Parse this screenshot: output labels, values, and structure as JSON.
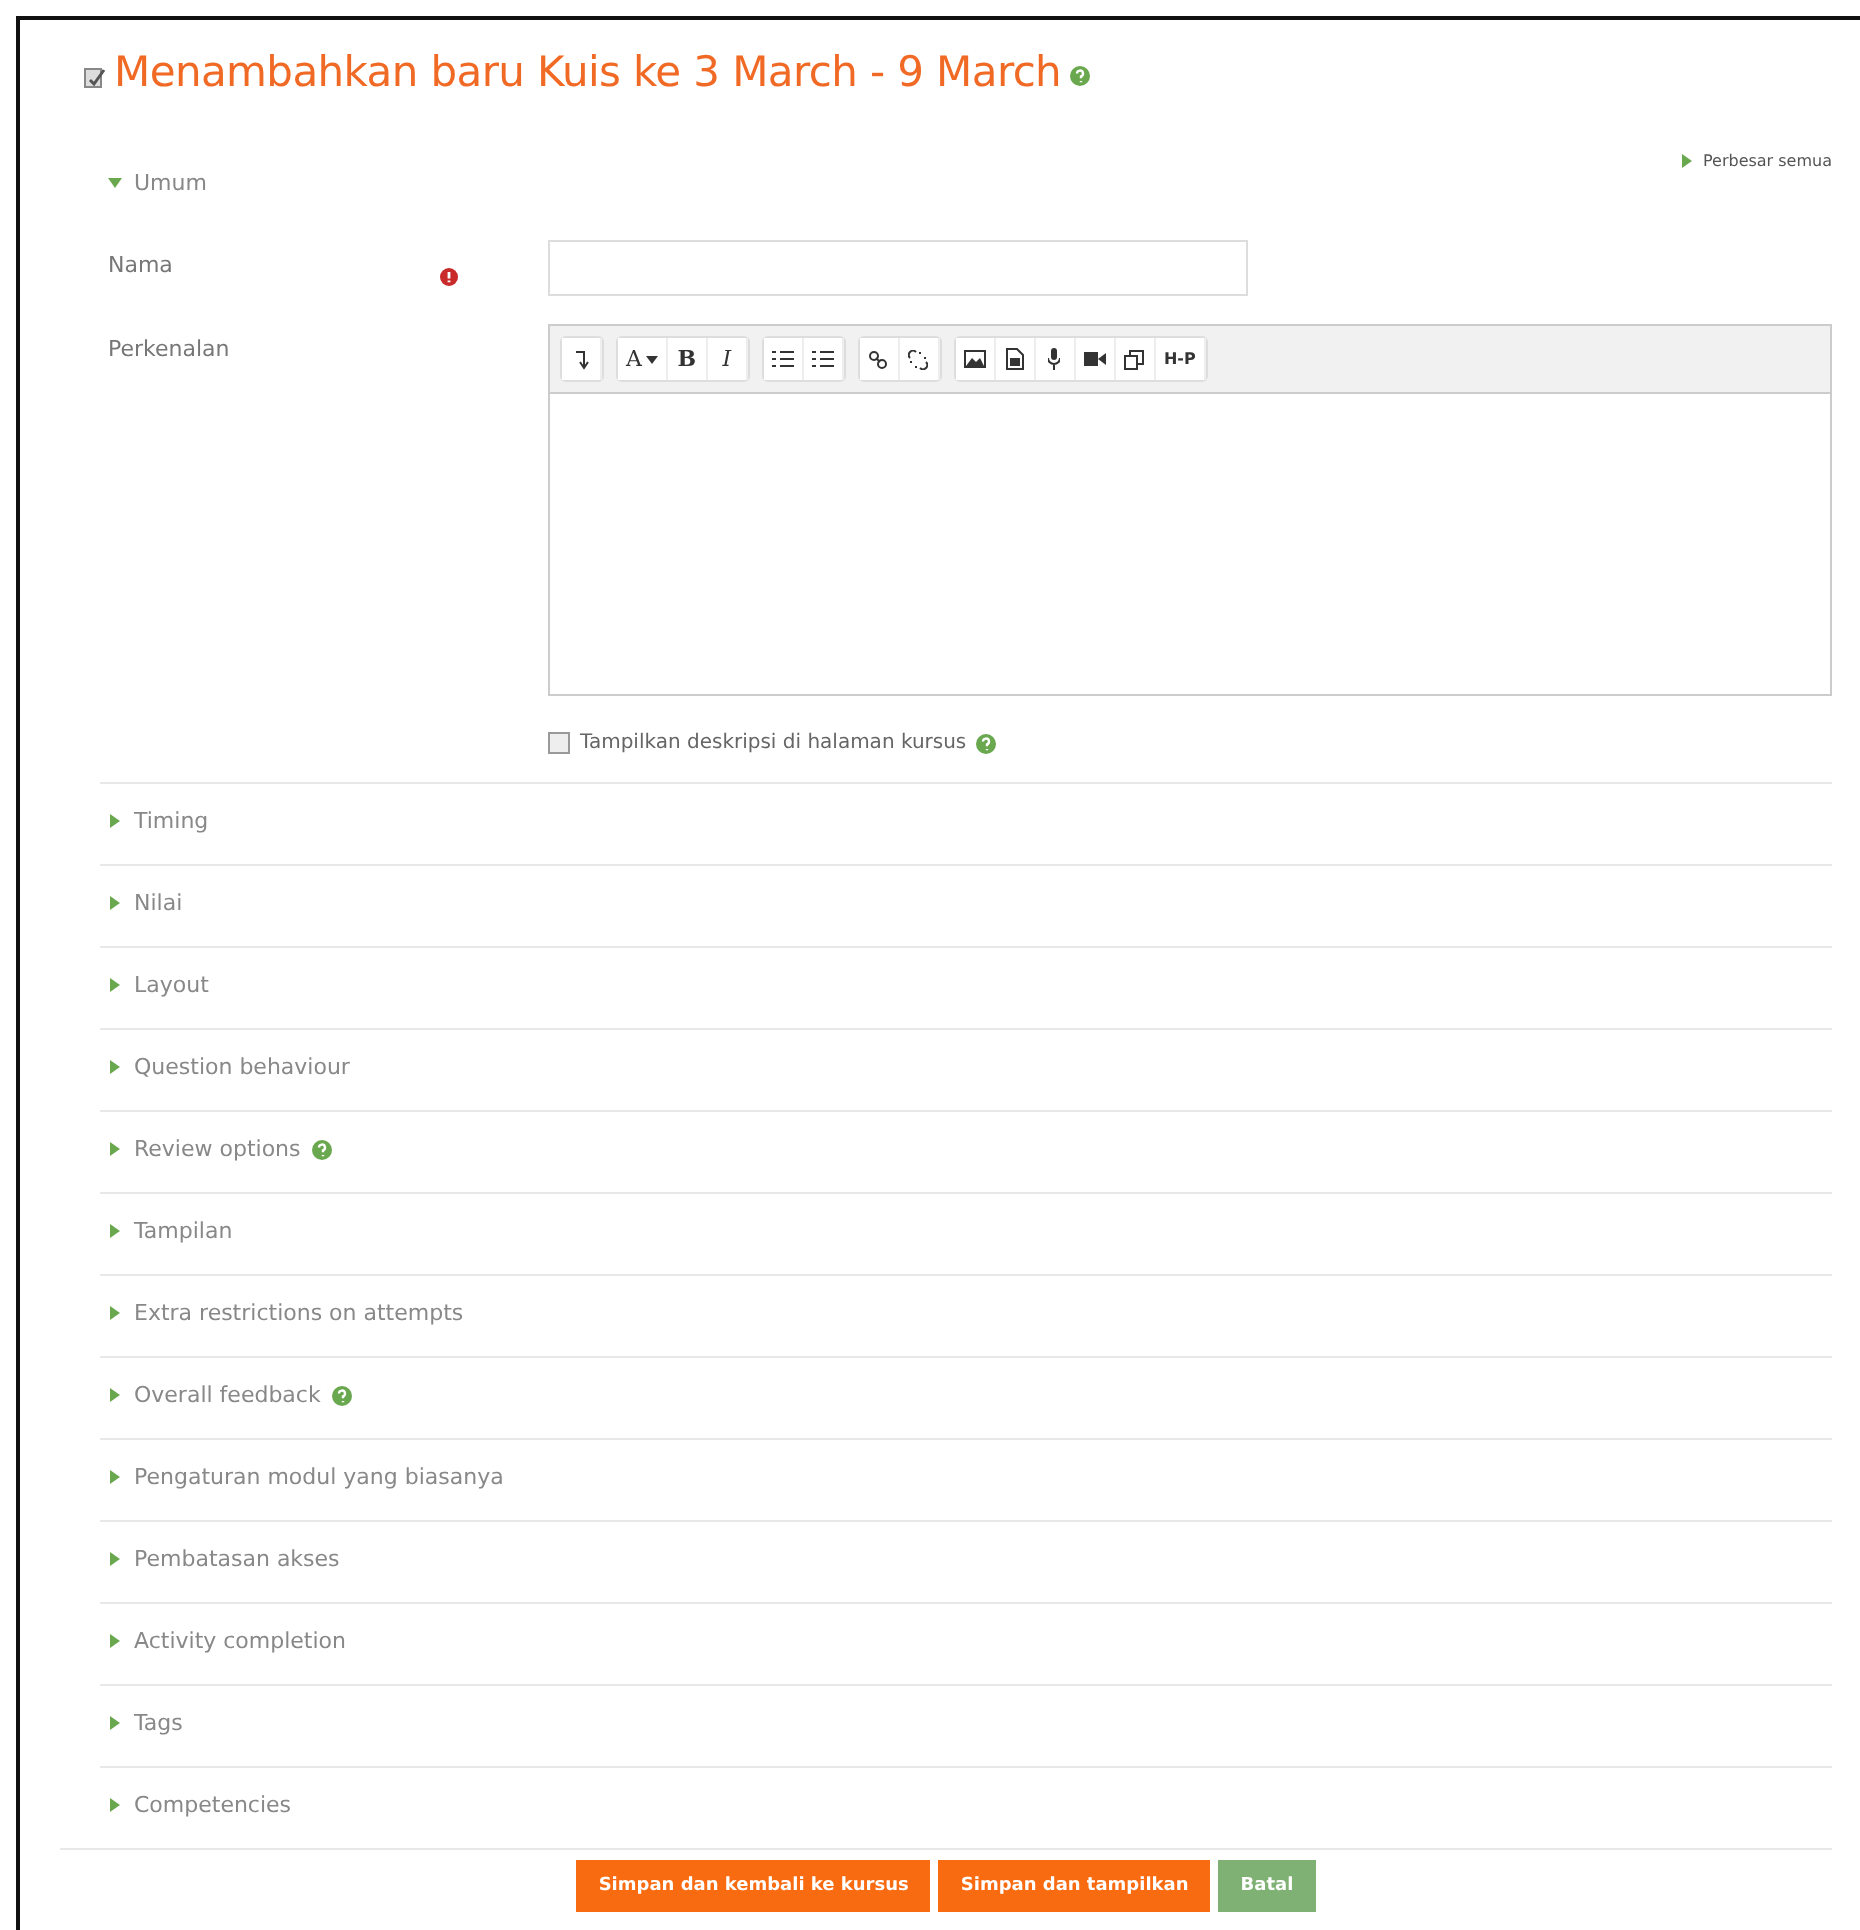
{
  "page": {
    "title": "Menambahkan baru Kuis ke 3 March - 9 March",
    "title_help": true
  },
  "expand_all": "Perbesar semua",
  "general": {
    "label": "Umum",
    "expanded": true
  },
  "fields": {
    "name": {
      "label": "Nama",
      "required": true
    },
    "intro": {
      "label": "Perkenalan"
    }
  },
  "toolbar": [
    [
      {
        "kind": "collapse"
      }
    ],
    [
      {
        "kind": "font",
        "label": "A"
      },
      {
        "kind": "bold",
        "label": "B"
      },
      {
        "kind": "italic",
        "label": "I"
      }
    ],
    [
      {
        "kind": "bullets"
      },
      {
        "kind": "numbers"
      }
    ],
    [
      {
        "kind": "link"
      },
      {
        "kind": "unlink"
      }
    ],
    [
      {
        "kind": "image"
      },
      {
        "kind": "media"
      },
      {
        "kind": "record"
      },
      {
        "kind": "video"
      },
      {
        "kind": "files"
      },
      {
        "kind": "h5p",
        "label": "H-P"
      }
    ]
  ],
  "show_description": {
    "label": "Tampilkan deskripsi di halaman kursus",
    "checked": false,
    "help": true
  },
  "sections": [
    {
      "label": "Timing",
      "expanded": false,
      "help": false
    },
    {
      "label": "Nilai",
      "expanded": false,
      "help": false
    },
    {
      "label": "Layout",
      "expanded": false,
      "help": false
    },
    {
      "label": "Question behaviour",
      "expanded": false,
      "help": false
    },
    {
      "label": "Review options",
      "expanded": false,
      "help": true
    },
    {
      "label": "Tampilan",
      "expanded": false,
      "help": false
    },
    {
      "label": "Extra restrictions on attempts",
      "expanded": false,
      "help": false
    },
    {
      "label": "Overall feedback",
      "expanded": false,
      "help": true
    },
    {
      "label": "Pengaturan modul yang biasanya",
      "expanded": false,
      "help": false
    },
    {
      "label": "Pembatasan akses",
      "expanded": false,
      "help": false
    },
    {
      "label": "Activity completion",
      "expanded": false,
      "help": false
    },
    {
      "label": "Tags",
      "expanded": false,
      "help": false
    },
    {
      "label": "Competencies",
      "expanded": false,
      "help": false
    }
  ],
  "buttons": [
    {
      "label": "Simpan dan kembali ke kursus",
      "kind": "primary"
    },
    {
      "label": "Simpan dan tampilkan",
      "kind": "primary"
    },
    {
      "label": "Batal",
      "kind": "secondary"
    }
  ]
}
